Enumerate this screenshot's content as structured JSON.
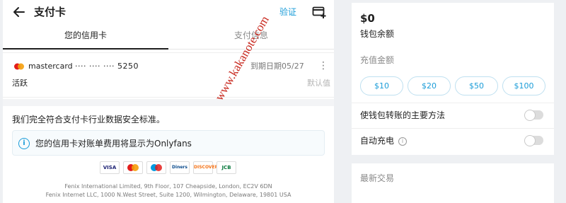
{
  "header": {
    "title": "支付卡",
    "verify_label": "验证"
  },
  "tabs": [
    {
      "label": "您的信用卡",
      "active": true
    },
    {
      "label": "支付信息",
      "active": false
    }
  ],
  "card": {
    "brand": "mastercard",
    "number_masked": "···· ···· ···· 5250",
    "expiry": "到期日期05/27",
    "status": "活跃",
    "default_label": "默认值"
  },
  "security": {
    "statement": "我们完全符合支付卡行业数据安全标准。",
    "notice": "您的信用卡对账单费用将显示为Onlyfans"
  },
  "brands": [
    "VISA",
    "MC",
    "Maestro",
    "Diners",
    "DISCOVER",
    "JCB"
  ],
  "address": {
    "line1": "Fenix International Limited, 9th Floor, 107 Cheapside, London, EC2V 6DN",
    "line2": "Fenix Internet LLC, 1000 N.West Street, Suite 1200, Wilmington, Delaware, 19801 USA"
  },
  "watermark": "www.kakanote.com",
  "wallet": {
    "balance": "$0",
    "balance_label": "钱包余额",
    "topup_label": "充值金额",
    "amounts": [
      "$10",
      "$20",
      "$50",
      "$100"
    ],
    "main_method_label": "使钱包转账的主要方法",
    "main_method_on": false,
    "auto_recharge_label": "自动充电",
    "auto_recharge_on": false
  },
  "transactions": {
    "title": "最新交易"
  },
  "colors": {
    "accent": "#1a9cd8",
    "watermark": "#c8281e"
  }
}
